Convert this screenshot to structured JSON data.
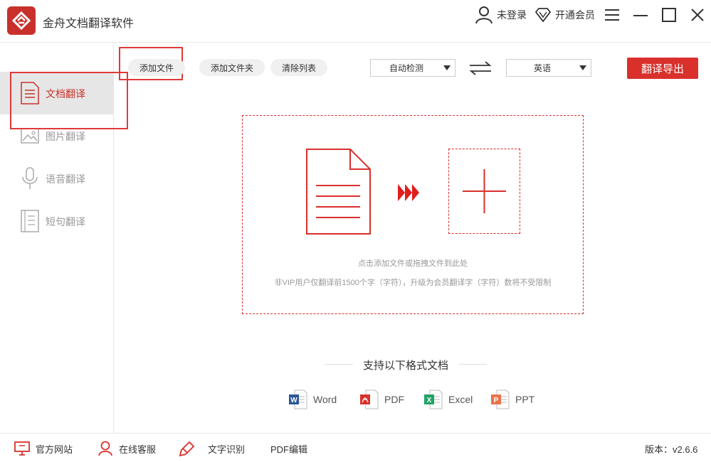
{
  "app": {
    "title": "金舟文档翻译软件"
  },
  "header": {
    "login_label": "未登录",
    "vip_label": "开通会员"
  },
  "sidebar": {
    "items": [
      {
        "label": "文档翻译",
        "icon": "document-icon",
        "active": true
      },
      {
        "label": "图片翻译",
        "icon": "image-icon",
        "active": false
      },
      {
        "label": "语音翻译",
        "icon": "microphone-icon",
        "active": false
      },
      {
        "label": "短句翻译",
        "icon": "text-icon",
        "active": false
      }
    ]
  },
  "toolbar": {
    "add_file": "添加文件",
    "add_folder": "添加文件夹",
    "clear_list": "清除列表",
    "source_lang": "自动检测",
    "target_lang": "英语",
    "export_label": "翻译导出"
  },
  "dropzone": {
    "hint": "点击添加文件或拖拽文件到此处",
    "note": "非VIP用户仅翻译前1500个字（字符），升级为会员翻译字（字符）数将不受限制"
  },
  "formats": {
    "title": "支持以下格式文档",
    "items": [
      {
        "label": "Word",
        "letter": "W",
        "color": "#2b5797"
      },
      {
        "label": "PDF",
        "letter": "",
        "color": "#d9302c"
      },
      {
        "label": "Excel",
        "letter": "X",
        "color": "#21a366"
      },
      {
        "label": "PPT",
        "letter": "P",
        "color": "#e8744a"
      }
    ]
  },
  "footer": {
    "website": "官方网站",
    "support": "在线客服",
    "ocr": "文字识别",
    "pdf_edit": "PDF编辑",
    "version": "版本：v2.6.6"
  },
  "colors": {
    "accent": "#d9302c",
    "sidebar_active_bg": "#e6e6e6"
  }
}
